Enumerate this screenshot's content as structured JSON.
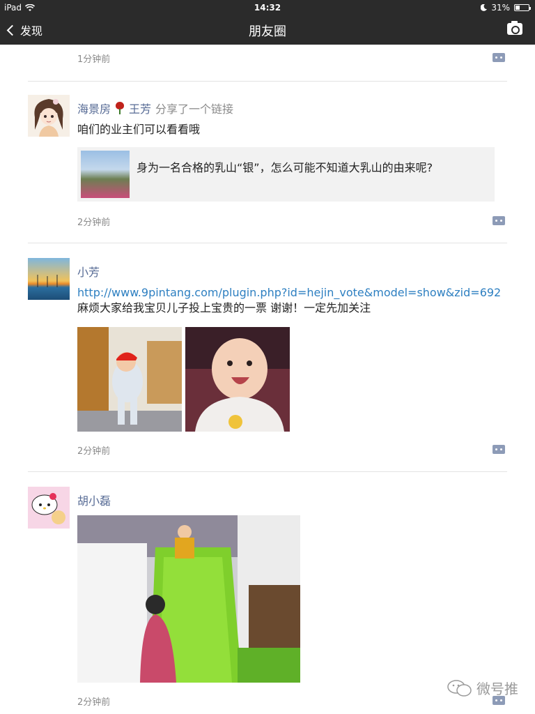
{
  "status_bar": {
    "device": "iPad",
    "time": "14:32",
    "battery": "31%",
    "battery_fraction": 0.31
  },
  "nav": {
    "back_label": "发现",
    "title": "朋友圈"
  },
  "posts": [
    {
      "time": "1分钟前"
    },
    {
      "name": "海景房",
      "shared_name": "王芳",
      "share_text": "分享了一个链接",
      "text": "咱们的业主们可以看看哦",
      "link_title": "身为一名合格的乳山“银”，怎么可能不知道大乳山的由来呢?",
      "time": "2分钟前"
    },
    {
      "name": "小芳",
      "url": "http://www.9pintang.com/plugin.php?id=hejin_vote&model=show&zid=692",
      "text": "麻烦大家给我宝贝儿子投上宝贵的一票  谢谢！一定先加关注",
      "time": "2分钟前"
    },
    {
      "name": "胡小磊",
      "time": "2分钟前"
    }
  ],
  "watermark": "微号推",
  "colors": {
    "bar": "#2b2b2b",
    "name": "#576b95",
    "link": "#2d7fc1",
    "timestamp": "#8a8a8a"
  }
}
